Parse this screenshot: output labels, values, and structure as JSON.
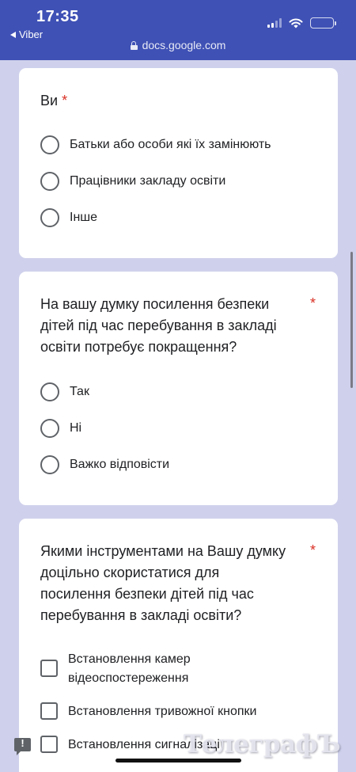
{
  "status_bar": {
    "time": "17:35",
    "back_app": "Viber",
    "url": "docs.google.com",
    "icons": [
      "signal-icon",
      "wifi-icon",
      "battery-icon"
    ]
  },
  "form": {
    "required_marker": "*",
    "questions": [
      {
        "title": "Ви",
        "type": "radio",
        "options": [
          "Батьки або особи які їх замінюють",
          "Працівники закладу освіти",
          "Інше"
        ]
      },
      {
        "title_lines": [
          "На вашу думку посилення безпеки",
          "дітей під час перебування в закладі",
          "освіти потребує покращення?"
        ],
        "type": "radio",
        "options": [
          "Так",
          "Ні",
          "Важко відповісти"
        ]
      },
      {
        "title_lines": [
          "Якими інструментами на Вашу думку",
          "доцільно скористатися для",
          "посилення безпеки дітей під час",
          "перебування в закладі освіти?"
        ],
        "type": "checkbox",
        "options": [
          {
            "lines": [
              "Встановлення камер",
              "відеоспостереження"
            ]
          },
          {
            "lines": [
              "Встановлення тривожної кнопки"
            ]
          },
          {
            "lines": [
              "Встановлення сигналізації"
            ]
          }
        ]
      }
    ]
  },
  "watermark": "ТелеграфЪ",
  "colors": {
    "header": "#3f51b5",
    "page_bg": "#cfd1ec",
    "required": "#d93025"
  }
}
